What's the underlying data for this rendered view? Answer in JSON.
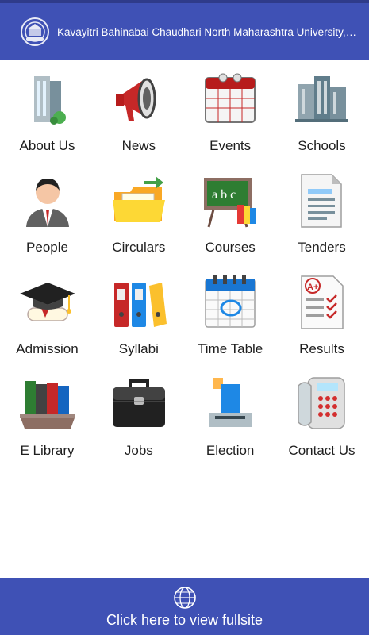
{
  "appbar": {
    "title": "Kavayitri Bahinabai Chaudhari North Maharashtra University, J..."
  },
  "tiles": [
    {
      "label": "About Us",
      "icon": "building-icon"
    },
    {
      "label": "News",
      "icon": "megaphone-icon"
    },
    {
      "label": "Events",
      "icon": "calendar-icon"
    },
    {
      "label": "Schools",
      "icon": "buildings-icon"
    },
    {
      "label": "People",
      "icon": "person-icon"
    },
    {
      "label": "Circulars",
      "icon": "folder-icon"
    },
    {
      "label": "Courses",
      "icon": "chalkboard-icon"
    },
    {
      "label": "Tenders",
      "icon": "document-icon"
    },
    {
      "label": "Admission",
      "icon": "graduation-cap-icon"
    },
    {
      "label": "Syllabi",
      "icon": "binders-icon"
    },
    {
      "label": "Time Table",
      "icon": "timetable-icon"
    },
    {
      "label": "Results",
      "icon": "result-sheet-icon"
    },
    {
      "label": "E Library",
      "icon": "books-icon"
    },
    {
      "label": "Jobs",
      "icon": "briefcase-icon"
    },
    {
      "label": "Election",
      "icon": "ballot-box-icon"
    },
    {
      "label": "Contact Us",
      "icon": "phone-icon"
    }
  ],
  "footer": {
    "label": "Click here to view fullsite",
    "icon": "globe-www-icon"
  },
  "colors": {
    "primary": "#3f51b5",
    "primary_dark": "#2f3b8a"
  }
}
